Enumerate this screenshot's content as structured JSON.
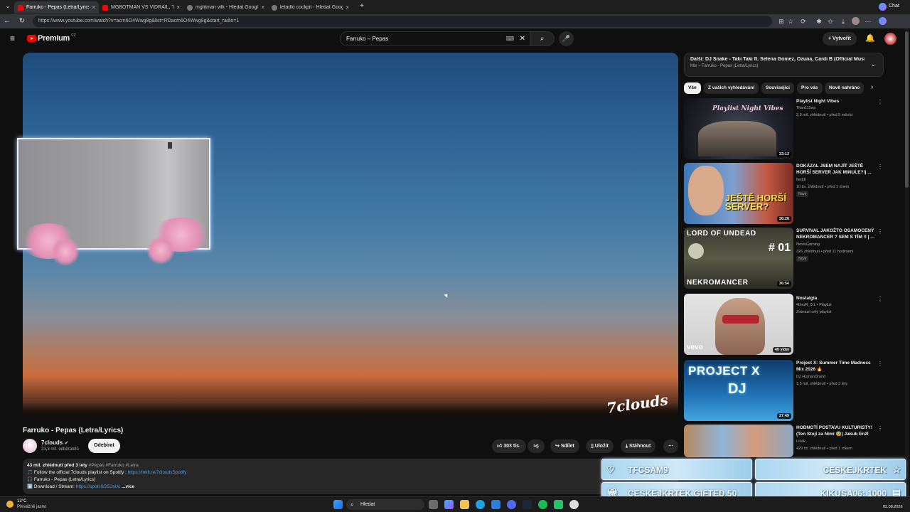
{
  "browser": {
    "tabs": [
      {
        "title": "Farruko - Pepas (Letra/Lyrics)",
        "active": true
      },
      {
        "title": "MGBOTMAN VS VIDRAIL, TARY FL",
        "active": false
      },
      {
        "title": "mgfitman vilk - Hledat Googlem",
        "active": false
      },
      {
        "title": "letadlo cockpit - Hledat Googlem",
        "active": false
      }
    ],
    "url": "https://www.youtube.com/watch?v=acm6O4Wwg8g&list=RDacm6O4Wwg8g&start_radio=1",
    "chat_label": "Chat"
  },
  "youtube": {
    "logo_text": "Premium",
    "logo_region": "CZ",
    "search_value": "Farruko – Pepas",
    "create_label": "Vytvořit"
  },
  "video": {
    "watermark": "7clouds",
    "title": "Farruko - Pepas (Letra/Lyrics)",
    "channel": "7clouds",
    "subscribers": "33,3 mil. odběratelů",
    "subscribe_label": "Odebírat",
    "actions": {
      "likes": "303 tis.",
      "share": "Sdílet",
      "save": "Uložit",
      "download": "Stáhnout"
    },
    "description": {
      "meta": "43 mil. zhlédnutí  před 3 lety",
      "hashtags": "#Pepas #Farruko #Letra",
      "line1_text": "🎵 Follow the official 7clouds playlist on Spotify : ",
      "line1_link": "https://lnkfi.re/7cloudsSpotify",
      "line2": "🎧 Farruko - Pepas (Letra/Lyrics)",
      "line3_text": "⬇️ Download / Stream: ",
      "line3_link": "https://spoti.fi/2SJsUc",
      "more": "...více"
    }
  },
  "sidebar": {
    "next_title": "Další: DJ Snake - Taki Taki ft. Selena Gomez, Ozuna, Cardi B (Official Music Vi...",
    "next_sub": "Mix – Farruko - Pepas (Letra/Lyrics)",
    "chips": [
      "Vše",
      "Z vašich vyhledávání",
      "Související",
      "Pro vás",
      "Nově nahráno"
    ],
    "recommendations": [
      {
        "title": "Playlist Night Vibes",
        "channel": "Titan111wp",
        "views": "2,5 mil. zhlédnutí • před 5 měsíci",
        "duration": "33:13",
        "badge": "",
        "thumb_text": "Playlist Night Vibes"
      },
      {
        "title": "DOKÁZAL JSEM NAJÍT JEŠTĚ HORŠÍ SERVER JAK MINULE?!| ...",
        "channel": "heddi",
        "views": "10 tis. zhlédnutí • před 1 dnem",
        "duration": "38:28",
        "badge": "Nový",
        "thumb_text": "JEŠTĚ HORŠÍ SERVER?"
      },
      {
        "title": "SURVIVAL JAKOŽTO OSAMOCENÝ NEKROMANCER ? SEM S TÍM !! | ...",
        "channel": "NexisGaming",
        "views": "326 zhlédnutí • před 11 hodinami",
        "duration": "36:54",
        "badge": "Nový",
        "thumb_text": "LORD OF UNDEAD",
        "thumb_text2": "NEKROMANCER",
        "thumb_text3": "# 01"
      },
      {
        "title": "Nostalgia",
        "channel": "4thruR_0.1 • Playlist",
        "views": "Zobrazit celý playlist",
        "duration": "40 videí",
        "badge": "",
        "thumb_text": "vevo"
      },
      {
        "title": "Project X: Summer Time Madness Mix 2026 🔥",
        "channel": "DJ HumanDrand",
        "views": "1,5 mil. zhlédnutí • před 3 lety",
        "duration": "27:49",
        "badge": "",
        "thumb_text": "PROJECT X",
        "thumb_text2": "DJ"
      },
      {
        "title": "HODNOTÍ POSTAVU KULTURISTY! (Ten Stojí za Nimi 😨) Jakub Enžl",
        "channel": "Lišák",
        "views": "429 tis. zhlédnutí • před 1 rokem",
        "duration": "",
        "badge": "",
        "thumb_text": ""
      }
    ]
  },
  "overlay": {
    "banner1_left": "TFCSAM9",
    "banner1_right": "CESKEJKRTEK",
    "banner2_left": "CESKEJKRTEK GIFTED 50",
    "banner2_right": "KIKUSA06: 1000"
  },
  "taskbar": {
    "temp": "13°C",
    "weather": "Převážně jasno",
    "search": "Hledat",
    "date": "02.08.2026"
  },
  "colors": {
    "yt_red": "#ff0000",
    "link_blue": "#3ea6ff",
    "background": "#0f0f0f"
  }
}
